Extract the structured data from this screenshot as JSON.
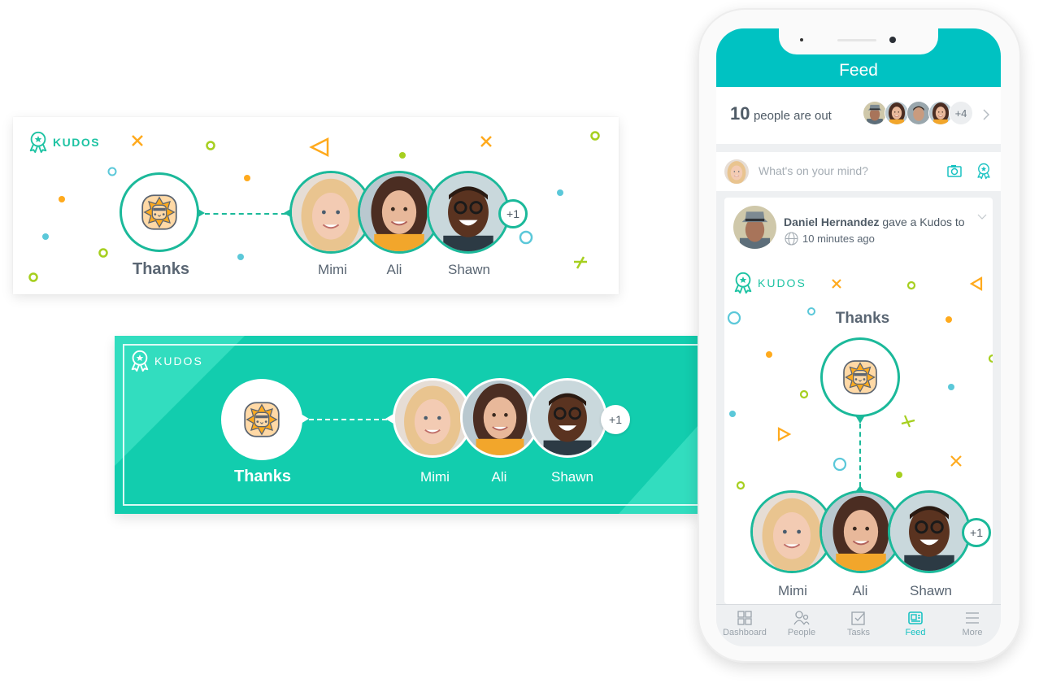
{
  "colors": {
    "brand_teal": "#1ec3a3",
    "card_teal": "#12cdae",
    "phone_header": "#00c2c2",
    "confetti_orange": "#ffaa1d",
    "confetti_green": "#a6cf1f",
    "confetti_blue": "#5bc8d9"
  },
  "kudos_card_white": {
    "brand": "KUDOS",
    "badge_label": "Thanks",
    "recipients": [
      {
        "name": "Mimi"
      },
      {
        "name": "Ali"
      },
      {
        "name": "Shawn"
      }
    ],
    "extra_count": "+1"
  },
  "kudos_card_teal": {
    "brand": "KUDOS",
    "badge_label": "Thanks",
    "recipients": [
      {
        "name": "Mimi"
      },
      {
        "name": "Ali"
      },
      {
        "name": "Shawn"
      }
    ],
    "extra_count": "+1"
  },
  "phone": {
    "header_title": "Feed",
    "out_summary": {
      "count": "10",
      "text": "people are out",
      "extra_avatars": "+4"
    },
    "composer": {
      "placeholder": "What's on your mind?"
    },
    "post": {
      "author": "Daniel Hernandez",
      "action": "gave a Kudos to",
      "time": "10 minutes ago",
      "kudos": {
        "brand": "KUDOS",
        "badge_label": "Thanks",
        "recipients": [
          {
            "name": "Mimi"
          },
          {
            "name": "Ali"
          },
          {
            "name": "Shawn"
          }
        ],
        "extra_count": "+1"
      }
    },
    "tabs": [
      {
        "label": "Dashboard",
        "icon": "grid-icon",
        "active": false
      },
      {
        "label": "People",
        "icon": "people-icon",
        "active": false
      },
      {
        "label": "Tasks",
        "icon": "tasks-icon",
        "active": false
      },
      {
        "label": "Feed",
        "icon": "feed-icon",
        "active": true
      },
      {
        "label": "More",
        "icon": "menu-icon",
        "active": false
      }
    ]
  }
}
